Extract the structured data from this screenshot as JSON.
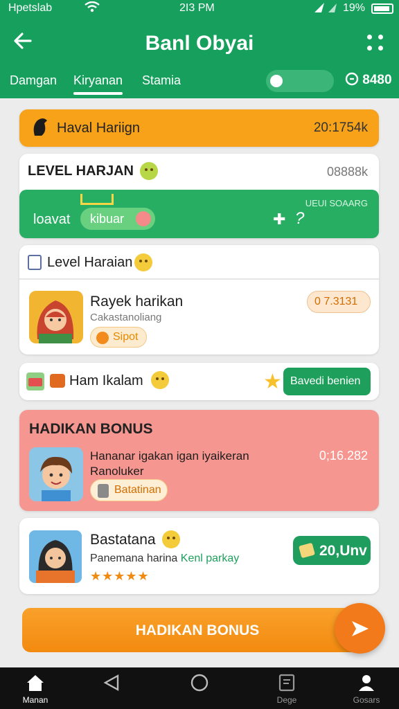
{
  "status_bar": {
    "carrier": "Hpetslab",
    "time": "2I3 PM",
    "battery": "19%"
  },
  "header": {
    "title": "Banl Obyai",
    "tabs": [
      "Damgan",
      "Kiryanan",
      "Stamia"
    ],
    "active_tab": 1,
    "coin_count": "8480"
  },
  "hariign": {
    "label": "Haval Hariign",
    "value": "20:1754k"
  },
  "level": {
    "label": "LEVEL HARJAN",
    "value": "08888k",
    "bar_label": "loavat",
    "pill_label": "kibuar",
    "bar_top_text": "UEUI SOAARG"
  },
  "daily": {
    "header_label": "Level Haraian",
    "name": "Rayek harikan",
    "subtitle": "Cakastanoliang",
    "chip_label": "Sipot",
    "badge": "0 7.3131"
  },
  "row": {
    "label": "Ham Ikalam",
    "button": "Bavedi benien"
  },
  "bonus": {
    "title": "HADIKAN BONUS",
    "description": "Hananar igakan igan iyaikeran Ranoluker",
    "value": "0;16.282",
    "chip_label": "Batatinan"
  },
  "basta": {
    "name": "Bastatana",
    "description_a": "Panemana harina",
    "description_b": "Kenl parkay",
    "rating": 5,
    "button": "20,Unv"
  },
  "primary_button": "HADIKAN BONUS",
  "bottom_nav": {
    "items": [
      "Manan",
      "",
      "",
      "Dege",
      "Gosars"
    ]
  },
  "colors": {
    "brand_green": "#17a05d",
    "accent_orange": "#f7a218",
    "bonus_pink": "#f69690"
  }
}
